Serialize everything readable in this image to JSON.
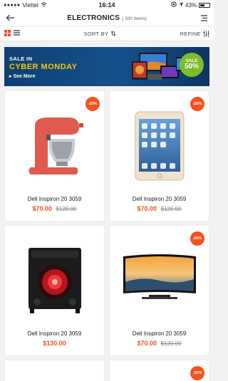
{
  "status": {
    "carrier": "Viettel",
    "time": "16:14",
    "battery": "43%",
    "battery_level": 0.43
  },
  "nav": {
    "title": "ELECTRONICS",
    "count": "( 200 Items)"
  },
  "toolbar": {
    "sort_label": "SORT BY",
    "refine_label": "REFINE"
  },
  "banner": {
    "line1": "SALE IN",
    "line2": "CYBER MONDAY",
    "link": "▸ See More",
    "badge_top": "SALE",
    "badge_value": "50%"
  },
  "products": [
    {
      "name": "Dell Inspiron 20 3059",
      "price": "$70.00",
      "old_price": "$120.00",
      "discount": "-20%",
      "icon": "stand-mixer-icon"
    },
    {
      "name": "Dell Inspiron 20 3059",
      "price": "$70.00",
      "old_price": "$120.00",
      "discount": "-20%",
      "icon": "tablet-icon"
    },
    {
      "name": "Dell Inspiron 20 3059",
      "price": "$130.00",
      "old_price": "",
      "discount": "",
      "icon": "speaker-icon"
    },
    {
      "name": "Dell Inspiron 20 3059",
      "price": "$70.00",
      "old_price": "$120.00",
      "discount": "-20%",
      "icon": "curved-tv-icon"
    },
    {
      "discount": ""
    },
    {
      "discount": "-20%"
    }
  ],
  "colors": {
    "accent": "#f4511e",
    "banner_bg": "#16508c",
    "banner_highlight": "#f6c40e",
    "badge_green": "#7cbd2b"
  }
}
